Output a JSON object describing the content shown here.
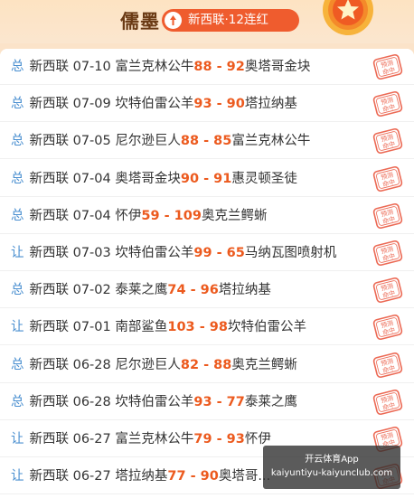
{
  "header": {
    "title": "儒墨",
    "streak_label": "新西联·12连红",
    "stamp_text": "预测命中"
  },
  "rows": [
    {
      "type": "总",
      "league": "新西联",
      "date": "07-10",
      "home": "富兰克林公牛",
      "home_score": "88",
      "away_score": "92",
      "away": "奥塔哥金块"
    },
    {
      "type": "总",
      "league": "新西联",
      "date": "07-09",
      "home": "坎特伯雷公羊",
      "home_score": "93",
      "away_score": "90",
      "away": "塔拉纳基"
    },
    {
      "type": "总",
      "league": "新西联",
      "date": "07-05",
      "home": "尼尔逊巨人",
      "home_score": "88",
      "away_score": "85",
      "away": "富兰克林公牛"
    },
    {
      "type": "总",
      "league": "新西联",
      "date": "07-04",
      "home": "奥塔哥金块",
      "home_score": "90",
      "away_score": "91",
      "away": "惠灵顿圣徒"
    },
    {
      "type": "总",
      "league": "新西联",
      "date": "07-04",
      "home": "怀伊",
      "home_score": "59",
      "away_score": "109",
      "away": "奥克兰鳄蜥"
    },
    {
      "type": "让",
      "league": "新西联",
      "date": "07-03",
      "home": "坎特伯雷公羊",
      "home_score": "99",
      "away_score": "65",
      "away": "马纳瓦图喷射机"
    },
    {
      "type": "总",
      "league": "新西联",
      "date": "07-02",
      "home": "泰莱之鹰",
      "home_score": "74",
      "away_score": "96",
      "away": "塔拉纳基"
    },
    {
      "type": "让",
      "league": "新西联",
      "date": "07-01",
      "home": "南部鲨鱼",
      "home_score": "103",
      "away_score": "98",
      "away": "坎特伯雷公羊"
    },
    {
      "type": "总",
      "league": "新西联",
      "date": "06-28",
      "home": "尼尔逊巨人",
      "home_score": "82",
      "away_score": "88",
      "away": "奥克兰鳄蜥"
    },
    {
      "type": "总",
      "league": "新西联",
      "date": "06-28",
      "home": "坎特伯雷公羊",
      "home_score": "93",
      "away_score": "77",
      "away": "泰莱之鹰"
    },
    {
      "type": "让",
      "league": "新西联",
      "date": "06-27",
      "home": "富兰克林公牛",
      "home_score": "79",
      "away_score": "93",
      "away": "怀伊"
    },
    {
      "type": "让",
      "league": "新西联",
      "date": "06-27",
      "home": "塔拉纳基",
      "home_score": "77",
      "away_score": "90",
      "away": "奥塔哥..."
    }
  ],
  "watermark": {
    "line1": "开云体育App",
    "line2": "kaiyuntiyu-kaiyunclub.com"
  },
  "colors": {
    "accent": "#ec5a1e",
    "type_label": "#4a8fd0",
    "streak_badge": "#ef5c2e"
  }
}
